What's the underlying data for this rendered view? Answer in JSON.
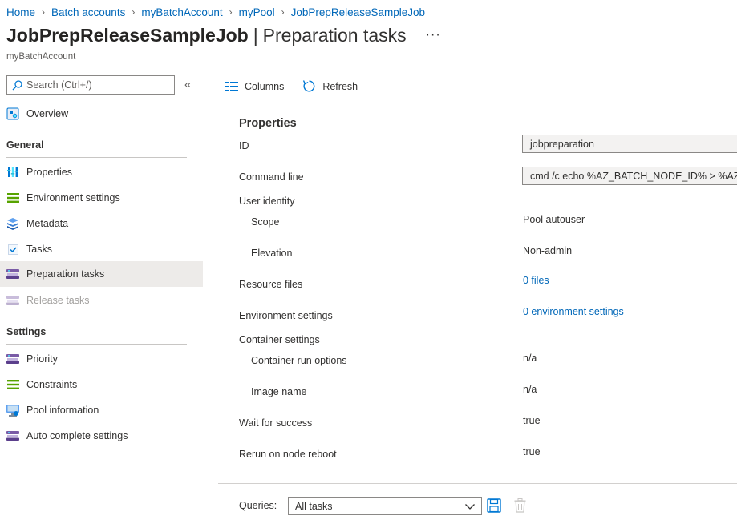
{
  "breadcrumb": {
    "items": [
      "Home",
      "Batch accounts",
      "myBatchAccount",
      "myPool",
      "JobPrepReleaseSampleJob"
    ],
    "separator": "›"
  },
  "header": {
    "title": "JobPrepReleaseSampleJob",
    "separator": "|",
    "subtitle": "Preparation tasks",
    "more": "···",
    "account": "myBatchAccount"
  },
  "sidebar": {
    "search_placeholder": "Search (Ctrl+/)",
    "collapse": "«",
    "overview": "Overview",
    "general_header": "General",
    "general_items": [
      {
        "label": "Properties",
        "icon": "properties-icon"
      },
      {
        "label": "Environment settings",
        "icon": "environment-settings-icon"
      },
      {
        "label": "Metadata",
        "icon": "metadata-icon"
      },
      {
        "label": "Tasks",
        "icon": "tasks-icon"
      },
      {
        "label": "Preparation tasks",
        "icon": "preparation-tasks-icon",
        "active": true
      },
      {
        "label": "Release tasks",
        "icon": "release-tasks-icon",
        "disabled": true
      }
    ],
    "settings_header": "Settings",
    "settings_items": [
      {
        "label": "Priority",
        "icon": "priority-icon"
      },
      {
        "label": "Constraints",
        "icon": "constraints-icon"
      },
      {
        "label": "Pool information",
        "icon": "pool-information-icon"
      },
      {
        "label": "Auto complete settings",
        "icon": "auto-complete-settings-icon"
      }
    ]
  },
  "toolbar": {
    "columns_label": "Columns",
    "refresh_label": "Refresh"
  },
  "properties": {
    "section_title": "Properties",
    "id_label": "ID",
    "id_value": "jobpreparation",
    "command_line_label": "Command line",
    "command_line_value": "cmd /c echo %AZ_BATCH_NODE_ID% > %AZ_BATCH_NODE_SHARED_DIR%\\shared_file.txt",
    "user_identity_label": "User identity",
    "scope_label": "Scope",
    "scope_value": "Pool autouser",
    "elevation_label": "Elevation",
    "elevation_value": "Non-admin",
    "resource_files_label": "Resource files",
    "resource_files_value": "0 files",
    "environment_settings_label": "Environment settings",
    "environment_settings_value": "0 environment settings",
    "container_settings_label": "Container settings",
    "container_run_options_label": "Container run options",
    "container_run_options_value": "n/a",
    "image_name_label": "Image name",
    "image_name_value": "n/a",
    "wait_for_success_label": "Wait for success",
    "wait_for_success_value": "true",
    "rerun_label": "Rerun on node reboot",
    "rerun_value": "true"
  },
  "queries": {
    "label": "Queries:",
    "selected": "All tasks"
  },
  "colors": {
    "link": "#0067b8",
    "active_bg": "#edebe9",
    "accent_blue": "#0078d4",
    "green_icon": "#57a300",
    "purple_icon": "#7a5ba6"
  }
}
